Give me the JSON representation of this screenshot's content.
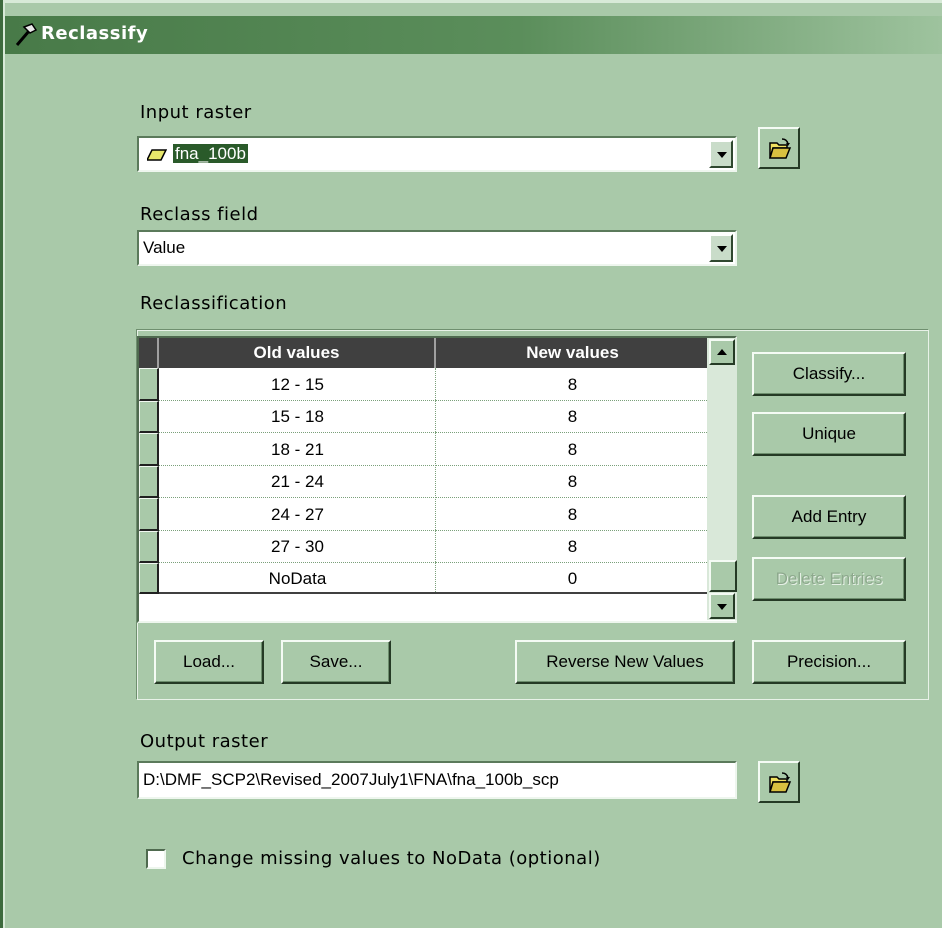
{
  "window": {
    "title": "Reclassify"
  },
  "input_raster": {
    "label": "Input raster",
    "value": "fna_100b"
  },
  "reclass_field": {
    "label": "Reclass field",
    "value": "Value"
  },
  "reclassification": {
    "label": "Reclassification",
    "columns": [
      "Old values",
      "New values"
    ],
    "rows": [
      {
        "old": "12 - 15",
        "new": "8"
      },
      {
        "old": "15 - 18",
        "new": "8"
      },
      {
        "old": "18 - 21",
        "new": "8"
      },
      {
        "old": "21 - 24",
        "new": "8"
      },
      {
        "old": "24 - 27",
        "new": "8"
      },
      {
        "old": "27 - 30",
        "new": "8"
      },
      {
        "old": "NoData",
        "new": "0"
      }
    ],
    "buttons": {
      "classify": "Classify...",
      "unique": "Unique",
      "add_entry": "Add Entry",
      "delete_entries": "Delete Entries",
      "load": "Load...",
      "save": "Save...",
      "reverse": "Reverse New Values",
      "precision": "Precision..."
    }
  },
  "output_raster": {
    "label": "Output raster",
    "value": "D:\\DMF_SCP2\\Revised_2007July1\\FNA\\fna_100b_scp"
  },
  "change_missing": {
    "label": "Change missing values to NoData (optional)",
    "checked": false
  }
}
